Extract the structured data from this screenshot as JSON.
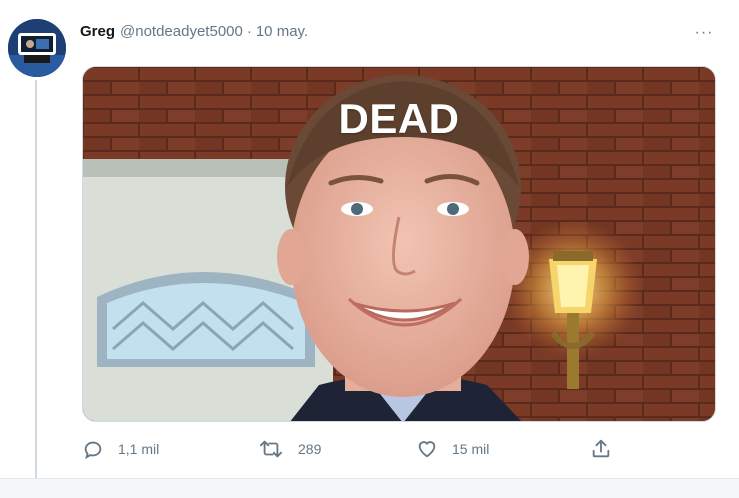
{
  "tweet": {
    "display_name": "Greg",
    "handle": "@notdeadyet5000",
    "separator": "·",
    "date": "10 may.",
    "more_icon": "ellipsis-icon",
    "more_label": "···",
    "image_overlay_text": "DEAD",
    "actions": {
      "reply": {
        "icon": "reply-icon",
        "count": "1,1 mil"
      },
      "retweet": {
        "icon": "retweet-icon",
        "count": "289"
      },
      "like": {
        "icon": "heart-icon",
        "count": "15 mil"
      },
      "share": {
        "icon": "share-icon"
      }
    }
  },
  "colors": {
    "name": "#14171a",
    "secondary": "#657786",
    "thread_line": "#cfd9de",
    "background": "#ffffff"
  }
}
